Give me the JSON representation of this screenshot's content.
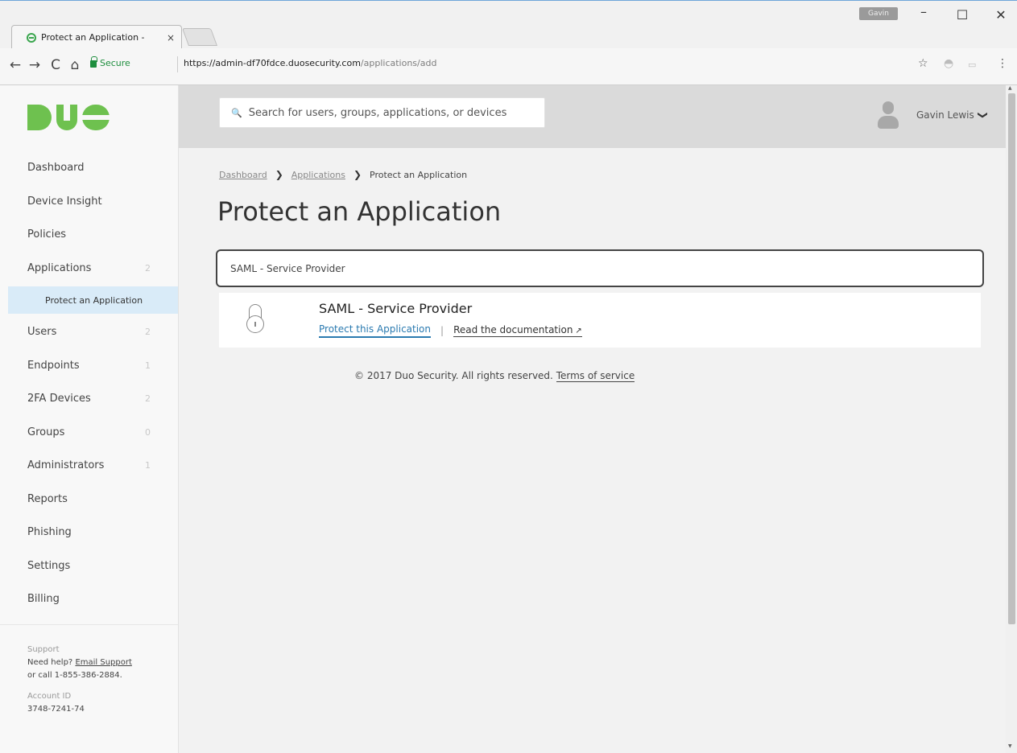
{
  "browser": {
    "tab_title": "Protect an Application -",
    "tab_close": "×",
    "profile_badge": "Gavin",
    "win_min": "–",
    "win_max": "☐",
    "win_close": "✕",
    "back": "←",
    "forward": "→",
    "reload": "C",
    "home": "⌂",
    "secure_label": "Secure",
    "url_host": "https://admin-df70fdce.duosecurity.com",
    "url_path": "/applications/add",
    "star": "☆",
    "ext1": "◓",
    "ext2": "▭",
    "menu": "⋮"
  },
  "sidebar": {
    "logo_alt": "DUO",
    "items": [
      {
        "label": "Dashboard",
        "count": ""
      },
      {
        "label": "Device Insight",
        "count": ""
      },
      {
        "label": "Policies",
        "count": ""
      },
      {
        "label": "Applications",
        "count": "2"
      }
    ],
    "sub_item": "Protect an Application",
    "items_after": [
      {
        "label": "Users",
        "count": "2"
      },
      {
        "label": "Endpoints",
        "count": "1"
      },
      {
        "label": "2FA Devices",
        "count": "2"
      },
      {
        "label": "Groups",
        "count": "0"
      },
      {
        "label": "Administrators",
        "count": "1"
      },
      {
        "label": "Reports",
        "count": ""
      },
      {
        "label": "Phishing",
        "count": ""
      },
      {
        "label": "Settings",
        "count": ""
      },
      {
        "label": "Billing",
        "count": ""
      }
    ],
    "support": {
      "heading": "Support",
      "need_help": "Need help?",
      "email_link": "Email Support",
      "call": "or call 1-855-386-2884.",
      "account_label": "Account ID",
      "account_id": "3748-7241-74"
    }
  },
  "header": {
    "search_icon": "🔍",
    "search_placeholder": "Search for users, groups, applications, or devices",
    "user_name": "Gavin Lewis",
    "chevron": "❯"
  },
  "content": {
    "breadcrumb": {
      "dashboard": "Dashboard",
      "applications": "Applications",
      "current": "Protect an Application",
      "sep": "❯"
    },
    "title": "Protect an Application",
    "filter_value": "SAML - Service Provider",
    "result": {
      "name": "SAML - Service Provider",
      "protect_link": "Protect this Application",
      "pipe": "|",
      "docs_link": "Read the documentation",
      "ext_icon": "↗"
    },
    "footer": {
      "copyright": "© 2017 Duo Security. All rights reserved.",
      "terms": "Terms of service"
    }
  }
}
